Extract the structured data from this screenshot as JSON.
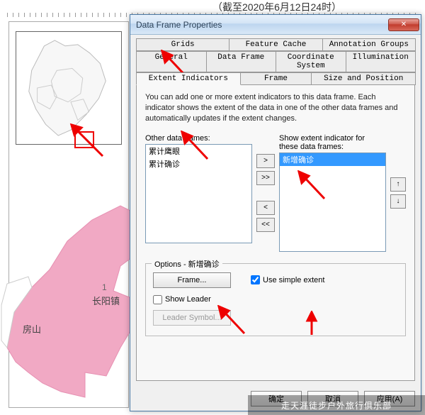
{
  "page_title": "（截至2020年6月12日24时）",
  "dialog": {
    "title": "Data Frame Properties",
    "tabs_row1": [
      "Grids",
      "Feature Cache",
      "Annotation Groups"
    ],
    "tabs_row2": [
      "General",
      "Data Frame",
      "Coordinate System",
      "Illumination"
    ],
    "tabs_row3": [
      "Extent Indicators",
      "Frame",
      "Size and Position"
    ],
    "active_tab": "Extent Indicators",
    "desc": "You can add one or more extent indicators to this data frame. Each indicator shows the extent of the data in one of the other data frames and automatically updates if the extent changes.",
    "other_label": "Other data frames:",
    "other_items": [
      "累计鹰眼",
      "累计确诊"
    ],
    "show_label": "Show extent indicator for these data frames:",
    "show_items": [
      "新增确诊"
    ],
    "move": {
      "add": ">",
      "add_all": ">>",
      "remove": "<",
      "remove_all": "<<"
    },
    "reorder": {
      "up": "↑",
      "down": "↓"
    },
    "options": {
      "legend": "Options - 新增确诊",
      "frame_btn": "Frame...",
      "use_simple": "Use simple extent",
      "use_simple_checked": true,
      "show_leader": "Show Leader",
      "show_leader_checked": false,
      "leader_symbol_btn": "Leader Symbol..."
    },
    "buttons": {
      "ok": "确定",
      "cancel": "取消",
      "apply": "应用(A)"
    }
  },
  "map": {
    "district_num": "1",
    "district_label": "长阳镇",
    "fangshan": "房山"
  },
  "watermark": "走天涯徒步户外旅行俱乐部"
}
